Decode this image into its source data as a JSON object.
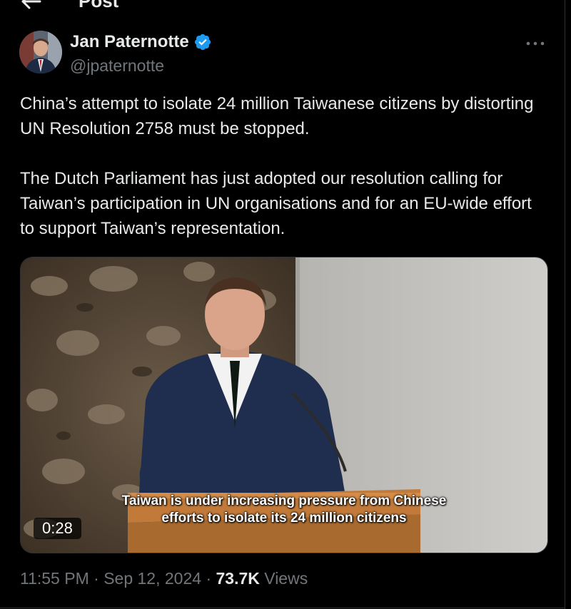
{
  "header": {
    "title": "Post"
  },
  "author": {
    "display_name": "Jan Paternotte",
    "handle": "@jpaternotte",
    "verified": true
  },
  "tweet": {
    "paragraphs": [
      "China’s attempt to isolate 24 million Taiwanese citizens by distorting UN Resolution 2758 must be stopped.",
      "The Dutch Parliament has just adopted our resolution calling for Taiwan’s participation in UN organisations and for an EU-wide effort to support Taiwan’s representation."
    ]
  },
  "video": {
    "subtitle_line1": "Taiwan is under increasing pressure from Chinese",
    "subtitle_line2": "efforts to isolate its 24 million citizens",
    "duration": "0:28"
  },
  "meta": {
    "time": "11:55 PM",
    "separator": "·",
    "date": "Sep 12, 2024",
    "views_count": "73.7K",
    "views_label": "Views"
  },
  "icons": {
    "back": "arrow-left-icon",
    "verified": "verified-badge-icon",
    "more": "more-horizontal-icon"
  },
  "colors": {
    "background": "#000000",
    "text_primary": "#e7e9ea",
    "text_secondary": "#71767b",
    "verified_blue": "#1d9bf0",
    "border": "#2f3336"
  }
}
